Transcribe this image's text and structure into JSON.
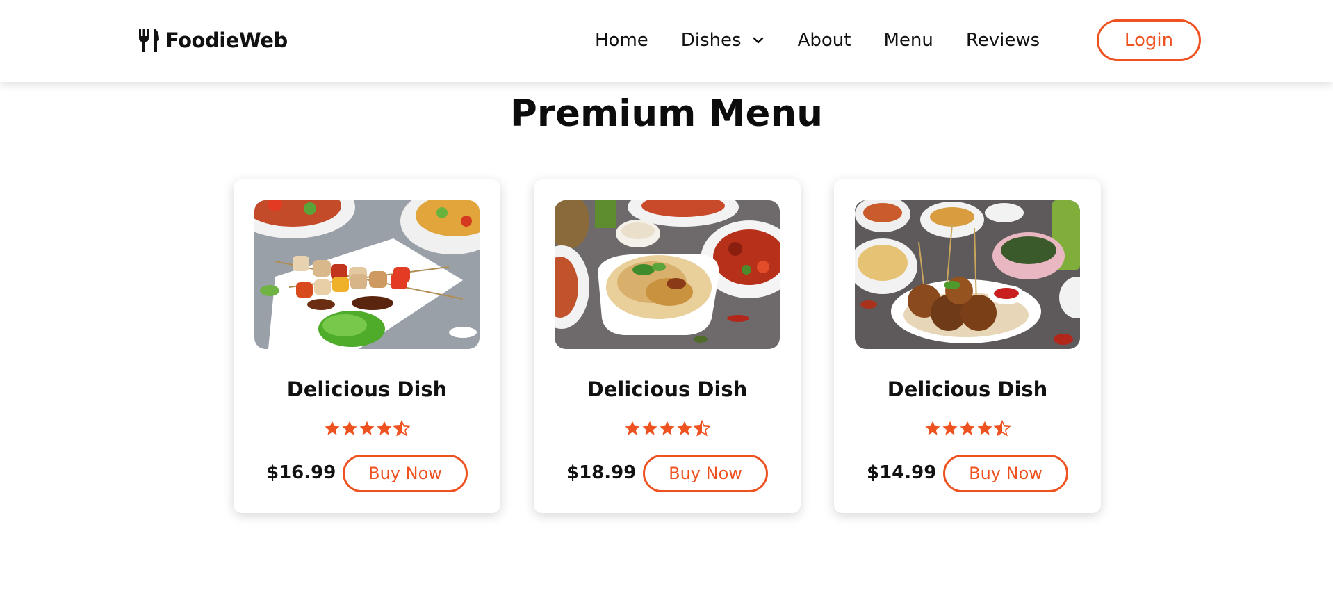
{
  "brand": {
    "name": "FoodieWeb",
    "icon": "fork-knife-icon"
  },
  "nav": {
    "items": [
      {
        "label": "Home"
      },
      {
        "label": "Dishes",
        "icon": "chevron-down-icon"
      },
      {
        "label": "About"
      },
      {
        "label": "Menu"
      },
      {
        "label": "Reviews"
      }
    ],
    "login_label": "Login"
  },
  "colors": {
    "accent": "#ee5220",
    "text": "#111111",
    "background": "#ffffff"
  },
  "section": {
    "title": "Premium Menu"
  },
  "cards": [
    {
      "title": "Delicious Dish",
      "rating": 4.5,
      "price": "$16.99",
      "button_label": "Buy Now",
      "image": "chicken-skewers-photo"
    },
    {
      "title": "Delicious Dish",
      "rating": 4.5,
      "price": "$18.99",
      "button_label": "Buy Now",
      "image": "biryani-rice-photo"
    },
    {
      "title": "Delicious Dish",
      "rating": 4.5,
      "price": "$14.99",
      "button_label": "Buy Now",
      "image": "fried-balls-photo"
    }
  ]
}
